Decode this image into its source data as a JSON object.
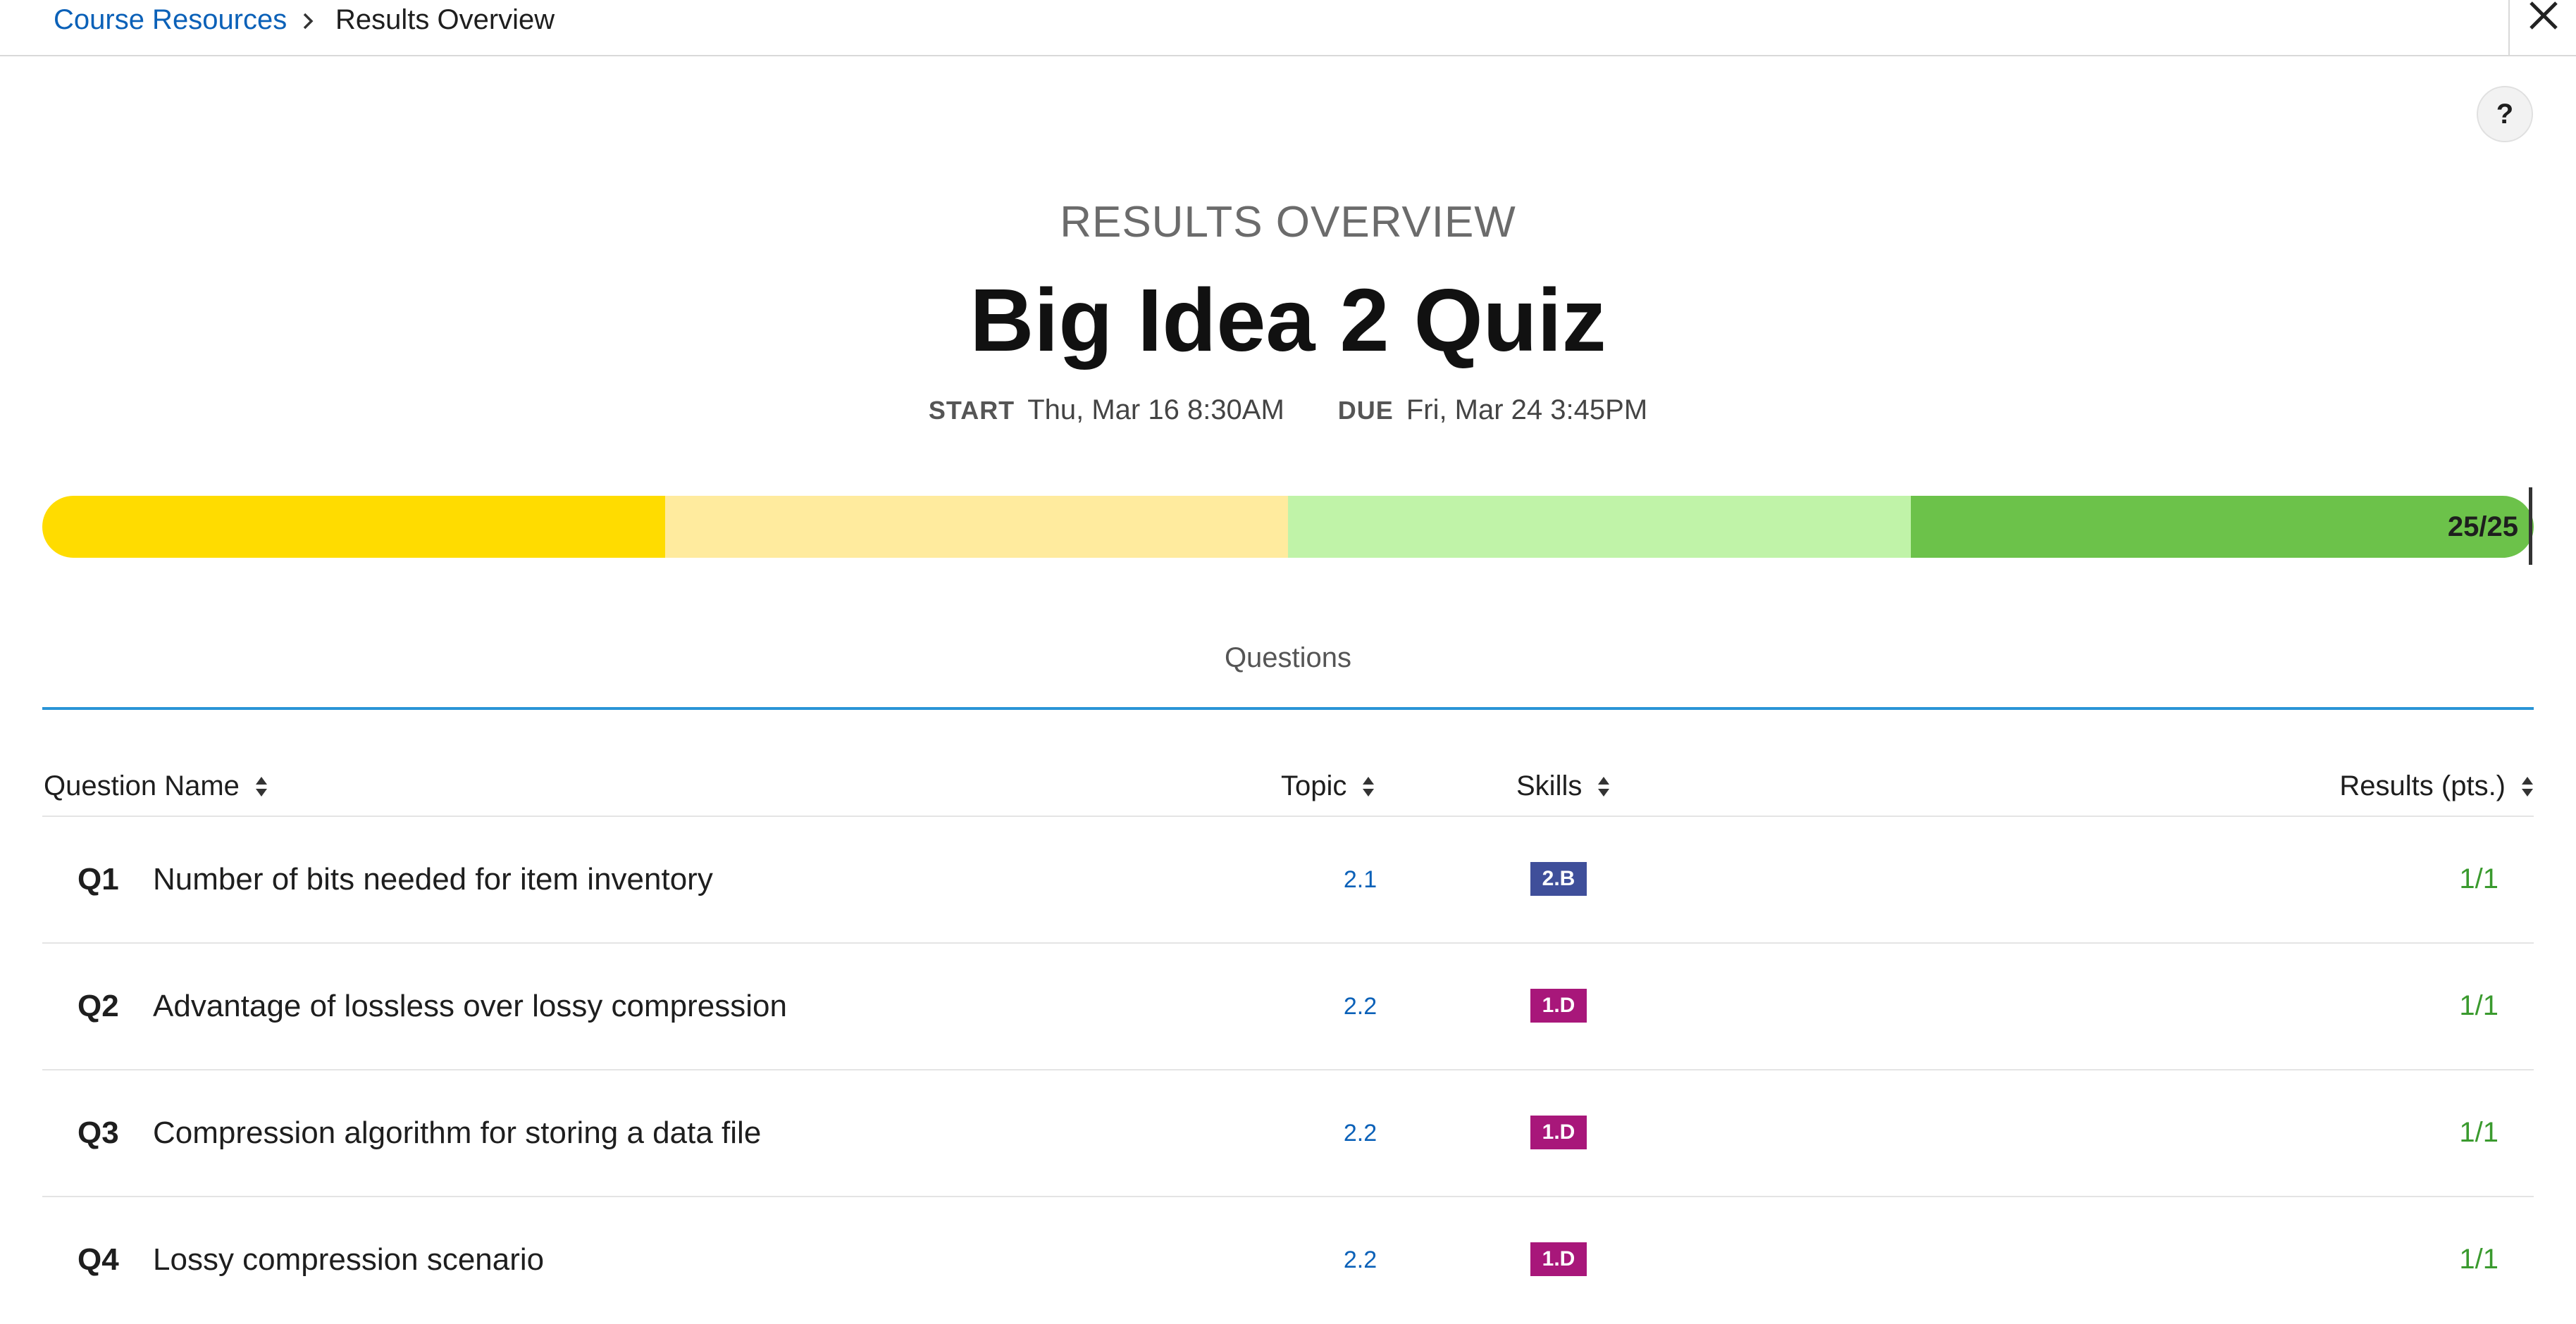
{
  "breadcrumb": {
    "parent": "Course Resources",
    "current": "Results Overview"
  },
  "header": {
    "eyebrow": "RESULTS OVERVIEW",
    "title": "Big Idea 2 Quiz",
    "start_label": "START",
    "start_value": "Thu, Mar 16 8:30AM",
    "due_label": "DUE",
    "due_value": "Fri, Mar 24 3:45PM"
  },
  "help_label": "?",
  "progress": {
    "score_label": "25/25",
    "segment_colors": [
      "#ffdc00",
      "#ffeb9e",
      "#c0f3a8",
      "#6cc24a"
    ]
  },
  "tabs": [
    {
      "label": "Questions",
      "active": true
    }
  ],
  "table": {
    "headers": {
      "name": "Question Name",
      "topic": "Topic",
      "skills": "Skills",
      "results": "Results (pts.)"
    },
    "rows": [
      {
        "num": "Q1",
        "name": "Number of bits needed for item inventory",
        "topic": "2.1",
        "skill": "2.B",
        "skill_color": "#3f4f9a",
        "result": "1/1"
      },
      {
        "num": "Q2",
        "name": "Advantage of lossless over lossy compression",
        "topic": "2.2",
        "skill": "1.D",
        "skill_color": "#a8177a",
        "result": "1/1"
      },
      {
        "num": "Q3",
        "name": "Compression algorithm for storing a data file",
        "topic": "2.2",
        "skill": "1.D",
        "skill_color": "#a8177a",
        "result": "1/1"
      },
      {
        "num": "Q4",
        "name": "Lossy compression scenario",
        "topic": "2.2",
        "skill": "1.D",
        "skill_color": "#a8177a",
        "result": "1/1"
      }
    ]
  },
  "icons": {
    "breadcrumb_separator": "chevron-right-icon",
    "close": "close-icon",
    "sort": "sort-icon"
  }
}
